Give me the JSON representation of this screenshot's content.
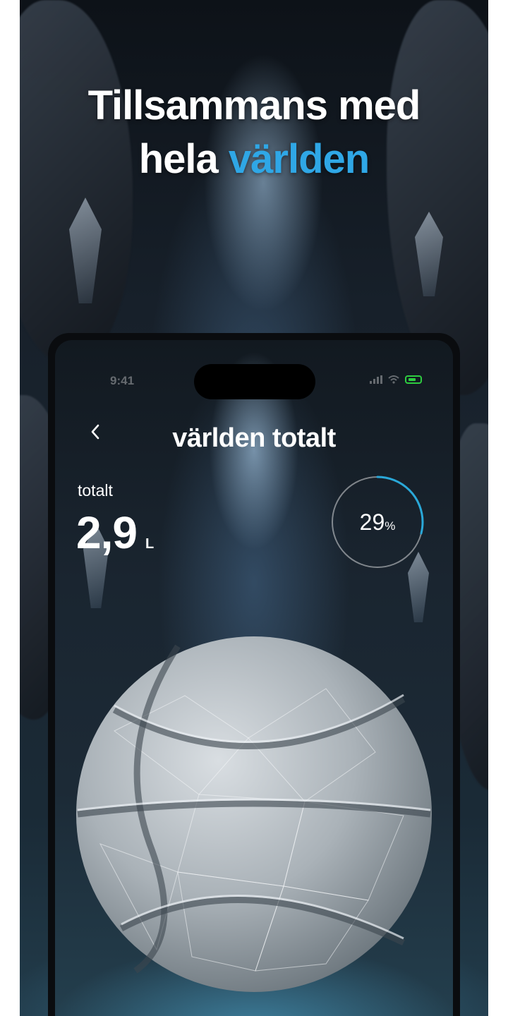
{
  "headline": {
    "line1": "Tillsammans med",
    "line2_prefix": "hela",
    "line2_accent": "världen",
    "accent_color": "#2fa7e6"
  },
  "phone": {
    "status_bar": {
      "time": "9:41",
      "icons": [
        "signal-icon",
        "wifi-icon",
        "battery-icon"
      ],
      "battery_color": "#2ecc40"
    },
    "nav": {
      "back_icon": "chevron-left-icon",
      "title": "världen totalt"
    },
    "total": {
      "label": "totalt",
      "value": "2,9",
      "unit": "L"
    },
    "progress": {
      "value": "29",
      "unit": "%",
      "fraction": 0.29,
      "ring_color": "#2aa8d8"
    },
    "hero_image": "crystal-basketball"
  }
}
